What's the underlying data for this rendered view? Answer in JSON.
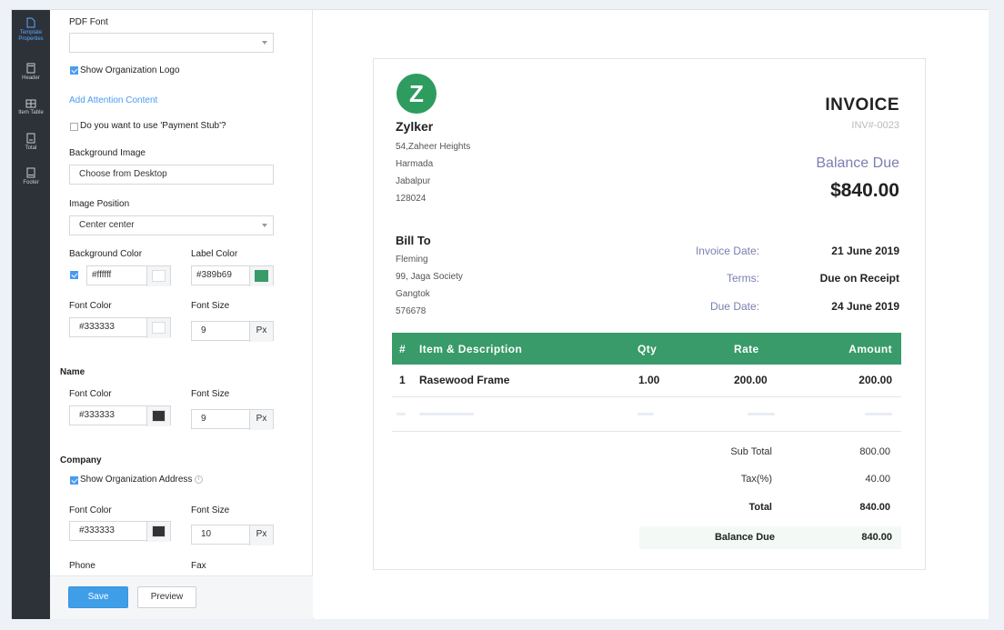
{
  "sidebar": {
    "items": [
      {
        "label": "Template Properties",
        "icon": "document-icon",
        "active": true
      },
      {
        "label": "Header",
        "icon": "header-icon"
      },
      {
        "label": "Item Table",
        "icon": "table-icon"
      },
      {
        "label": "Total",
        "icon": "total-icon"
      },
      {
        "label": "Footer",
        "icon": "footer-icon"
      }
    ]
  },
  "panel": {
    "pdf_font_label": "PDF Font",
    "pdf_font_value": "",
    "show_logo_label": "Show Organization Logo",
    "add_attention_link": "Add Attention Content",
    "payment_stub_label": "Do you want to use 'Payment Stub'?",
    "bg_image_label": "Background Image",
    "bg_image_button": "Choose from Desktop",
    "image_position_label": "Image Position",
    "image_position_value": "Center center",
    "bg_color_label": "Background Color",
    "bg_color_value": "#ffffff",
    "label_color_label": "Label Color",
    "label_color_value": "#389b69",
    "font_color_label": "Font Color",
    "font_color_value": "#333333",
    "font_size_label": "Font Size",
    "font_size_value": "9",
    "px_unit": "Px",
    "name_section": "Name",
    "name_font_color_label": "Font Color",
    "name_font_color_value": "#333333",
    "name_font_size_label": "Font Size",
    "name_font_size_value": "9",
    "company_section": "Company",
    "show_org_address_label": "Show Organization Address",
    "company_font_color_label": "Font Color",
    "company_font_color_value": "#333333",
    "company_font_size_label": "Font Size",
    "company_font_size_value": "10",
    "phone_label": "Phone",
    "fax_label": "Fax",
    "save_button": "Save",
    "preview_button": "Preview",
    "colors": {
      "label_swatch": "#389b69",
      "font_swatch": "#333333",
      "white_swatch": "#ffffff"
    }
  },
  "invoice": {
    "logo_letter": "Z",
    "company_name": "Zylker",
    "address": [
      "54,Zaheer Heights",
      "Harmada",
      "Jabalpur",
      "128024"
    ],
    "title": "INVOICE",
    "number": "INV#-0023",
    "balance_due_label": "Balance Due",
    "balance_due_value": "$840.00",
    "bill_to_label": "Bill To",
    "bill_to": [
      "Fleming",
      "99, Jaga Society",
      "Gangtok",
      "576678"
    ],
    "invoice_date_label": "Invoice Date:",
    "invoice_date_value": "21 June 2019",
    "terms_label": "Terms:",
    "terms_value": "Due on Receipt",
    "due_date_label": "Due Date:",
    "due_date_value": "24 June 2019",
    "table_headers": {
      "num": "#",
      "item": "Item & Description",
      "qty": "Qty",
      "rate": "Rate",
      "amount": "Amount"
    },
    "rows": [
      {
        "num": "1",
        "item": "Rasewood Frame",
        "qty": "1.00",
        "rate": "200.00",
        "amount": "200.00"
      }
    ],
    "sub_total_label": "Sub Total",
    "sub_total_value": "800.00",
    "tax_label": "Tax(%)",
    "tax_value": "40.00",
    "total_label": "Total",
    "total_value": "840.00",
    "balance_label": "Balance Due",
    "balance_value": "840.00",
    "accent": "#389b69"
  }
}
